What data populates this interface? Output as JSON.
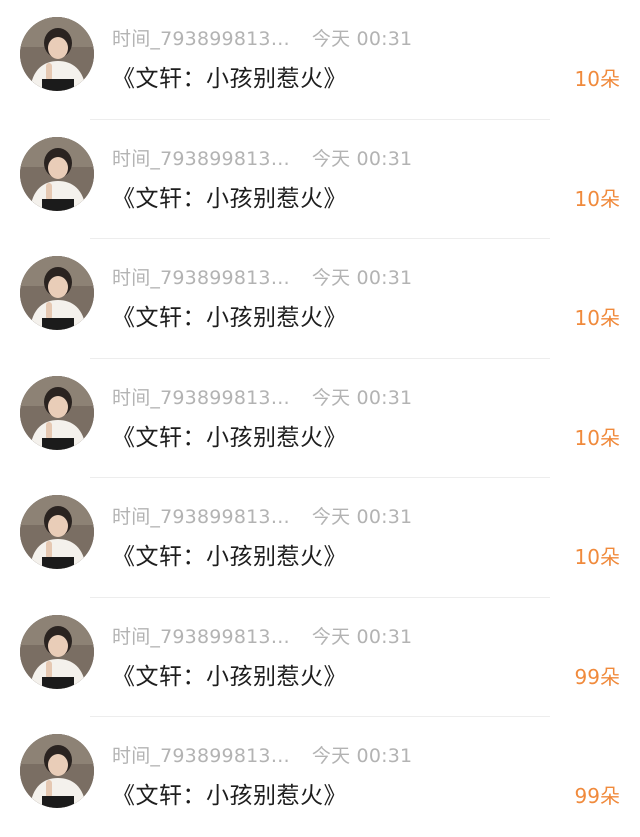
{
  "items": [
    {
      "username": "时间_793899813…",
      "time": "今天  00:31",
      "title": "《文轩：小孩别惹火》",
      "count": "10朵"
    },
    {
      "username": "时间_793899813…",
      "time": "今天  00:31",
      "title": "《文轩：小孩别惹火》",
      "count": "10朵"
    },
    {
      "username": "时间_793899813…",
      "time": "今天  00:31",
      "title": "《文轩：小孩别惹火》",
      "count": "10朵"
    },
    {
      "username": "时间_793899813…",
      "time": "今天  00:31",
      "title": "《文轩：小孩别惹火》",
      "count": "10朵"
    },
    {
      "username": "时间_793899813…",
      "time": "今天  00:31",
      "title": "《文轩：小孩别惹火》",
      "count": "10朵"
    },
    {
      "username": "时间_793899813…",
      "time": "今天  00:31",
      "title": "《文轩：小孩别惹火》",
      "count": "99朵"
    },
    {
      "username": "时间_793899813…",
      "time": "今天  00:31",
      "title": "《文轩：小孩别惹火》",
      "count": "99朵"
    }
  ],
  "colors": {
    "count_accent": "#f08a3c",
    "meta_gray": "#b3b3b3",
    "title_text": "#1e1e1e",
    "divider": "#ededed"
  }
}
